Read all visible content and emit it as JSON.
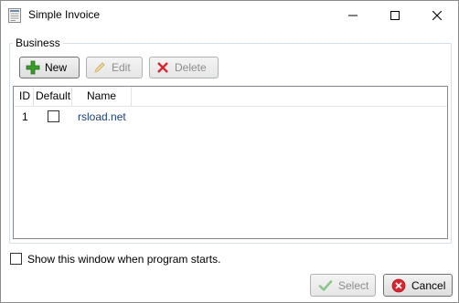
{
  "window": {
    "title": "Simple Invoice",
    "minimize_icon": "minimize-icon",
    "maximize_icon": "maximize-icon",
    "close_icon": "close-icon"
  },
  "business": {
    "group_label": "Business",
    "toolbar": {
      "new_label": "New",
      "edit_label": "Edit",
      "delete_label": "Delete",
      "new_enabled": true,
      "edit_enabled": false,
      "delete_enabled": false
    },
    "columns": [
      "ID",
      "Default",
      "Name"
    ],
    "rows": [
      {
        "id": "1",
        "default": false,
        "name": "rsload.net"
      }
    ]
  },
  "footer": {
    "show_on_start_label": "Show this window when program starts.",
    "show_on_start_checked": false,
    "select_label": "Select",
    "cancel_label": "Cancel",
    "select_enabled": false
  },
  "colors": {
    "name_link": "#1b3f7a",
    "new_icon_green": "#3a9a2a",
    "delete_icon_red": "#d9262e",
    "cancel_icon_red": "#d9262e",
    "select_icon_green": "#8cc78a"
  }
}
